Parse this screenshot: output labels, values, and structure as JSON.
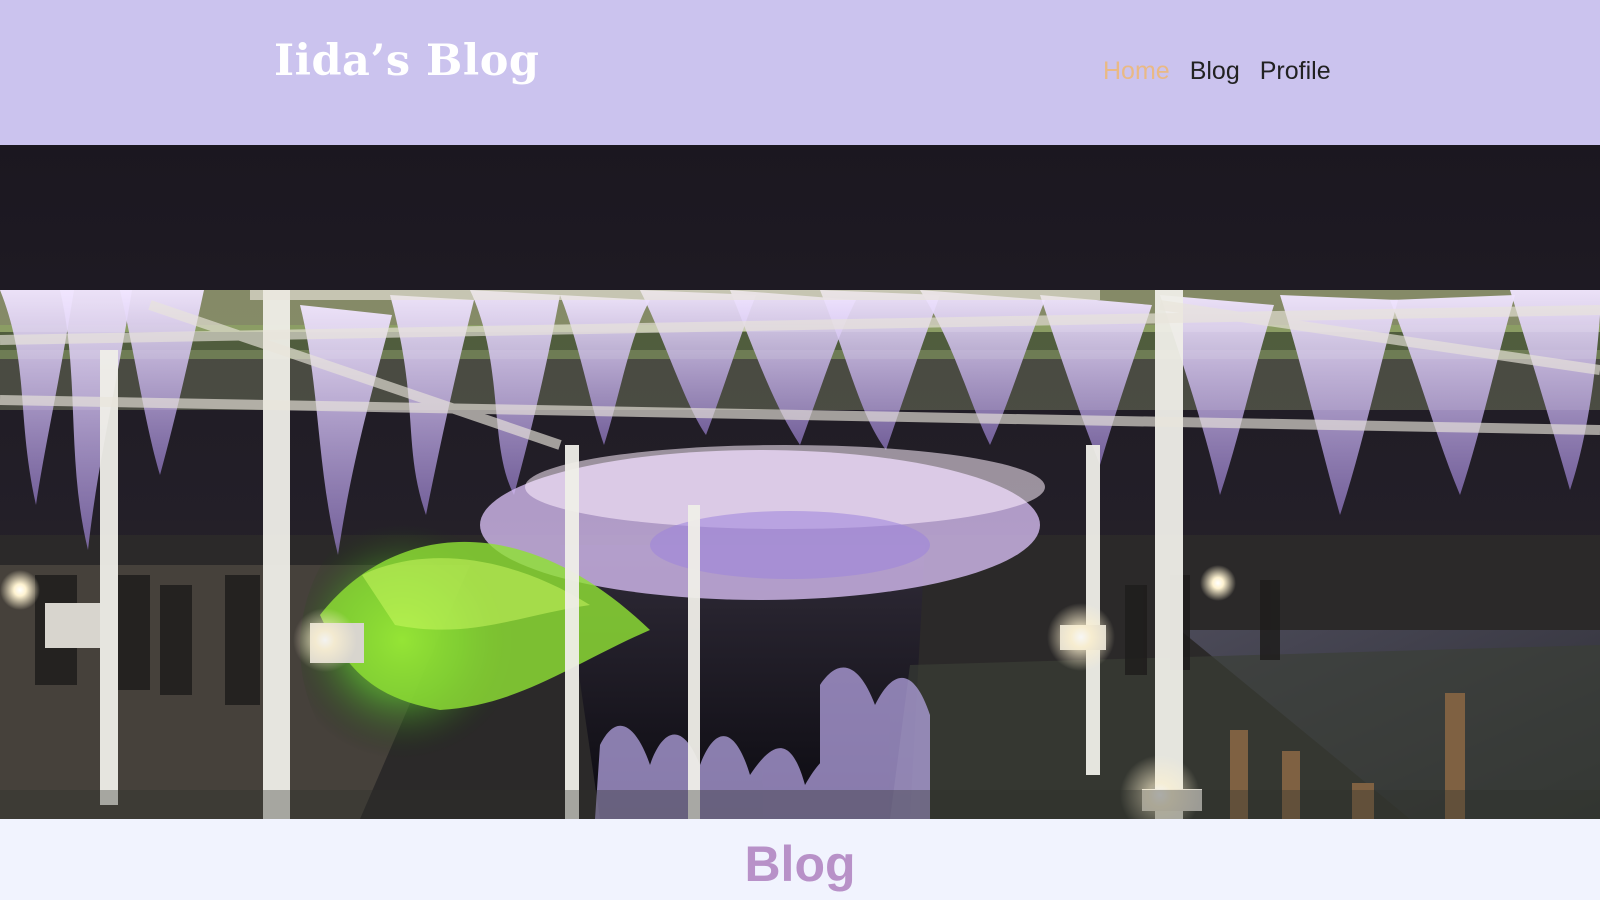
{
  "header": {
    "site_title": "Iida’s Blog",
    "nav": [
      {
        "label": "Home",
        "active": true
      },
      {
        "label": "Blog",
        "active": false
      },
      {
        "label": "Profile",
        "active": false
      }
    ]
  },
  "hero": {
    "image_subject": "night-wisteria-trellis-photo"
  },
  "main": {
    "section_title": "Blog"
  },
  "colors": {
    "header_bg": "#cbc3ee",
    "page_bg": "#f1f3fe",
    "active_nav": "#e9b985",
    "section_title": "#b891c8"
  }
}
